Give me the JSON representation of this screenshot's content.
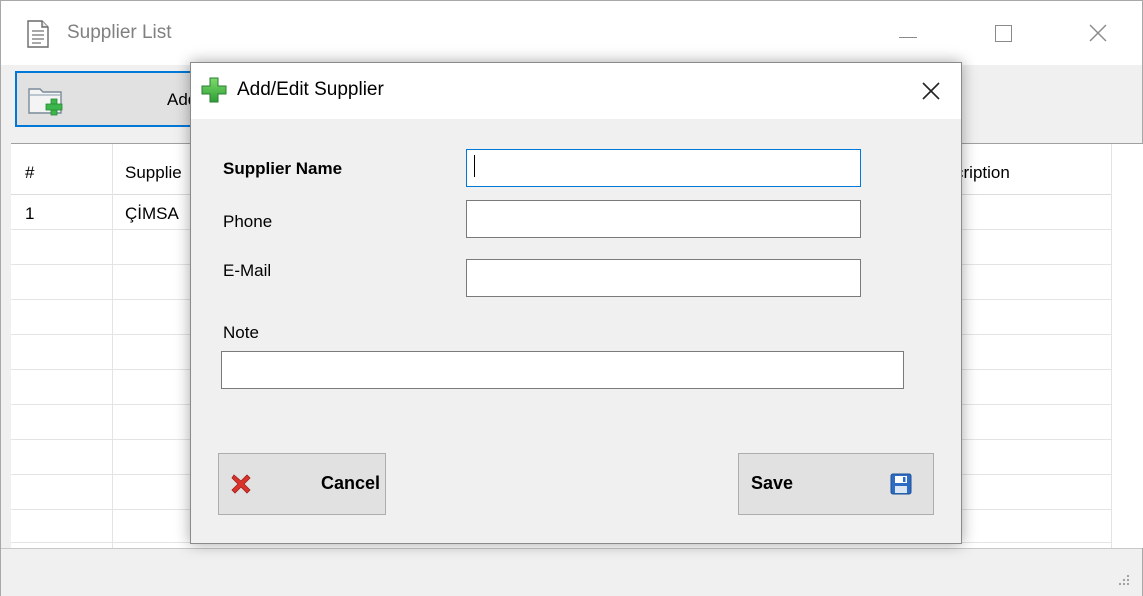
{
  "window": {
    "title": "Supplier List"
  },
  "toolbar": {
    "add_label": "Add"
  },
  "grid": {
    "columns": [
      "#",
      "Supplier",
      "Description"
    ],
    "visible_column_fragments": [
      "#",
      "Supplie",
      "cription"
    ],
    "rows": [
      {
        "num": "1",
        "supplier": "ÇİMSA"
      }
    ],
    "visible_cell_fragment": "ÇİMSA"
  },
  "dialog": {
    "title": "Add/Edit Supplier",
    "fields": {
      "supplier_name_label": "Supplier Name",
      "supplier_name_value": "",
      "phone_label": "Phone",
      "phone_value": "",
      "email_label": "E-Mail",
      "email_value": "",
      "note_label": "Note",
      "note_value": ""
    },
    "cancel_label": "Cancel",
    "save_label": "Save"
  },
  "colors": {
    "focus_accent": "#0078d7",
    "cancel_icon": "#d9332b",
    "add_icon": "#3bb64a",
    "save_icon": "#2d6cc4"
  },
  "icons": {
    "window": "document-icon",
    "add": "folder-add-icon",
    "dialog": "plus-icon",
    "cancel": "cancel-x-icon",
    "save": "floppy-disk-icon"
  }
}
